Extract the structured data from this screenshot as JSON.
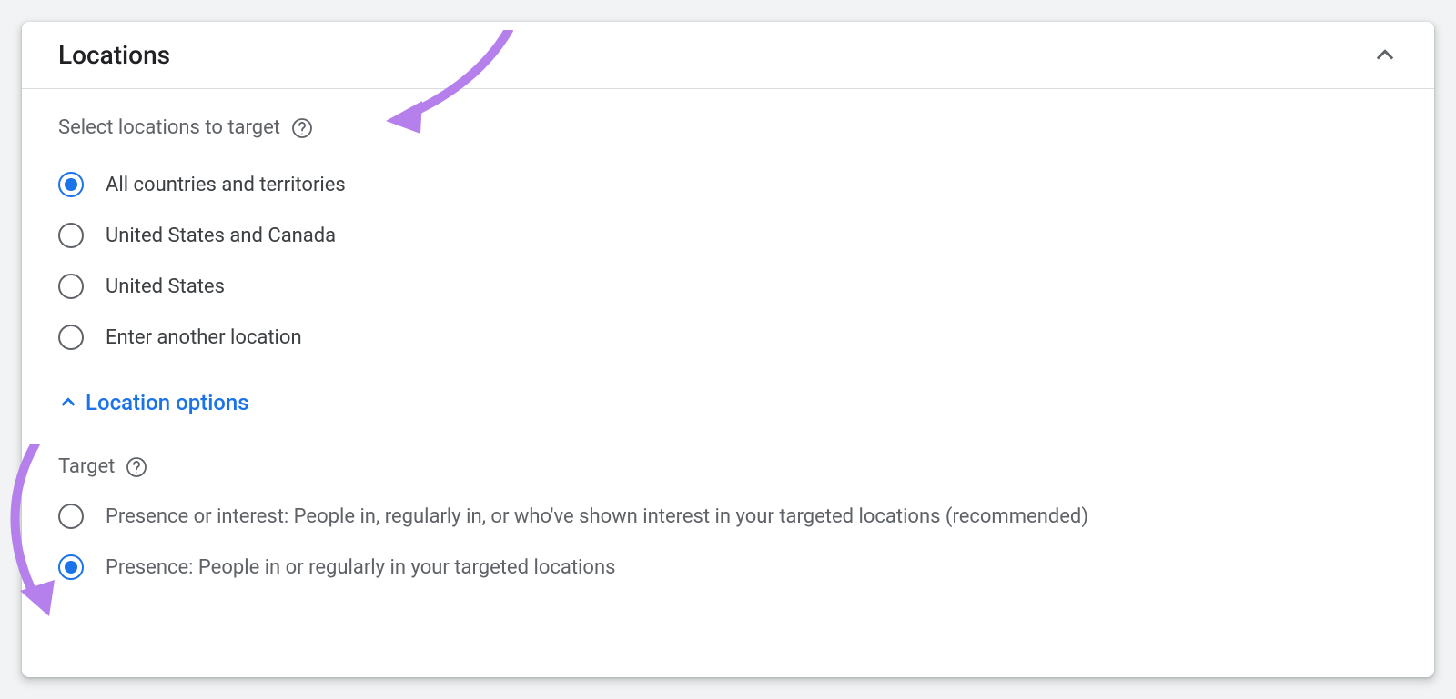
{
  "header": {
    "title": "Locations"
  },
  "select_section": {
    "label": "Select locations to target",
    "options": [
      {
        "label": "All countries and territories",
        "selected": true
      },
      {
        "label": "United States and Canada",
        "selected": false
      },
      {
        "label": "United States",
        "selected": false
      },
      {
        "label": "Enter another location",
        "selected": false
      }
    ]
  },
  "location_options": {
    "toggle_label": "Location options"
  },
  "target_section": {
    "label": "Target",
    "options": [
      {
        "label": "Presence or interest: People in, regularly in, or who've shown interest in your targeted locations (recommended)",
        "selected": false
      },
      {
        "label": "Presence: People in or regularly in your targeted locations",
        "selected": true
      }
    ]
  }
}
